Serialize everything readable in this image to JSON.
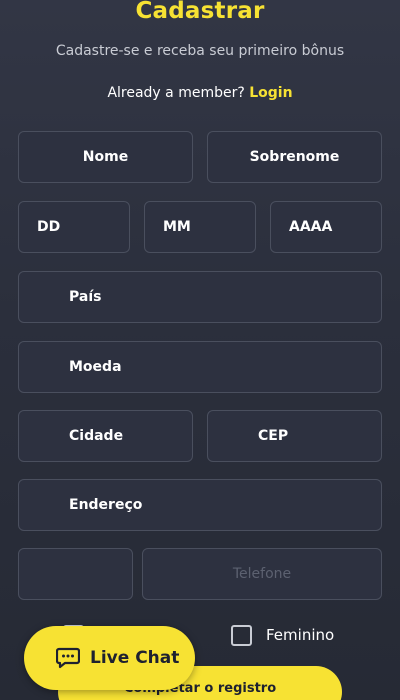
{
  "header": {
    "title": "Cadastrar",
    "subtitle": "Cadastre-se e receba seu primeiro bônus",
    "member_prompt": "Already a member?",
    "login_link": "Login"
  },
  "form": {
    "first_name": "Nome",
    "last_name": "Sobrenome",
    "day": "DD",
    "month": "MM",
    "year": "AAAA",
    "country": "País",
    "currency": "Moeda",
    "city": "Cidade",
    "zip": "CEP",
    "address": "Endereço",
    "phone_code": "",
    "phone_placeholder": "Telefone",
    "gender_female": "Feminino",
    "submit_label": "Completar o registro"
  },
  "chat": {
    "label": "Live Chat",
    "icon": "chat-bubble-icon"
  },
  "colors": {
    "accent": "#f7e233",
    "background": "#2b2f3c",
    "field_bg": "#2d3140",
    "field_border": "#4a4f5e"
  }
}
